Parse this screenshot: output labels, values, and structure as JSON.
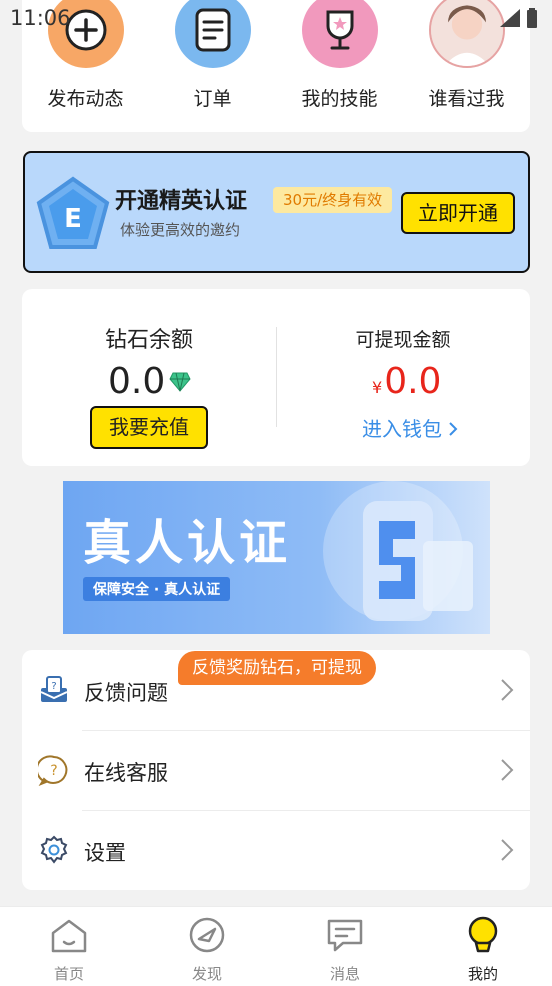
{
  "status_bar": {
    "time": "11:06"
  },
  "quick_actions": [
    {
      "label": "发布动态",
      "icon": "plus-icon",
      "color": "#f7a766"
    },
    {
      "label": "订单",
      "icon": "document-icon",
      "color": "#7bb8ef"
    },
    {
      "label": "我的技能",
      "icon": "trophy-icon",
      "color": "#f199bd"
    },
    {
      "label": "谁看过我",
      "icon": "avatar",
      "color": "#f4c7c7"
    }
  ],
  "vip_banner": {
    "badge_letter": "E",
    "title": "开通精英认证",
    "price_tag": "30元/终身有效",
    "subtitle": "体验更高效的邀约",
    "button_label": "立即开通"
  },
  "wallet": {
    "diamond_label": "钻石余额",
    "diamond_value": "0.0",
    "recharge_button": "我要充值",
    "cash_label": "可提现金额",
    "cash_currency": "¥",
    "cash_value": "0.0",
    "wallet_link": "进入钱包"
  },
  "real_banner": {
    "title": "真人认证",
    "subtitle": "保障安全 · 真人认证"
  },
  "menu": {
    "feedback_badge": "反馈奖励钻石，可提现",
    "items": [
      {
        "label": "反馈问题",
        "icon": "feedback-inbox-icon"
      },
      {
        "label": "在线客服",
        "icon": "customer-service-icon"
      },
      {
        "label": "设置",
        "icon": "settings-gear-icon"
      }
    ]
  },
  "bottom_nav": [
    {
      "label": "首页",
      "icon": "home-icon",
      "active": false
    },
    {
      "label": "发现",
      "icon": "discover-icon",
      "active": false
    },
    {
      "label": "消息",
      "icon": "message-icon",
      "active": false
    },
    {
      "label": "我的",
      "icon": "profile-bulb-icon",
      "active": true
    }
  ],
  "colors": {
    "accent_yellow": "#ffe100",
    "vip_blue": "#b9d8fb",
    "cash_red": "#e8251b",
    "link_blue": "#3a8ee6",
    "badge_orange": "#f57c2b"
  }
}
